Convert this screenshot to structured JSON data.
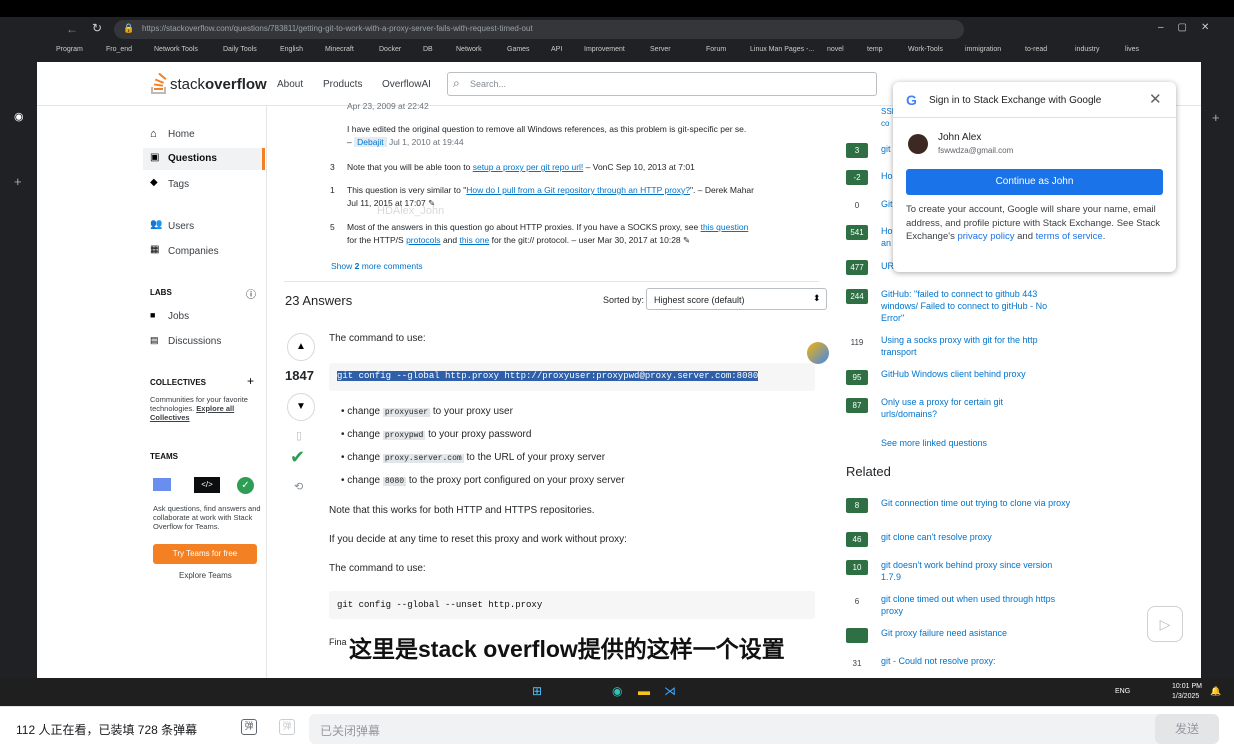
{
  "browser": {
    "url": "https://stackoverflow.com/questions/783811/getting-git-to-work-with-a-proxy-server-fails-with-request-timed-out",
    "bookmarks": [
      "Program",
      "Fro_end",
      "Network Tools",
      "Daily Tools",
      "English",
      "Minecraft",
      "Docker",
      "DB",
      "Network",
      "Games",
      "API",
      "Improvement",
      "Server",
      "Forum",
      "Linux Man Pages -...",
      "novel",
      "temp",
      "Work-Tools",
      "immigration",
      "to-read",
      "industry",
      "lives"
    ]
  },
  "so": {
    "logo_a": "stack",
    "logo_b": "overflow",
    "nav": [
      "About",
      "Products",
      "OverflowAI"
    ],
    "search_placeholder": "Search...",
    "left_nav": {
      "home": "Home",
      "questions": "Questions",
      "tags": "Tags",
      "users": "Users",
      "companies": "Companies"
    },
    "labs": {
      "title": "LABS",
      "jobs": "Jobs",
      "discussions": "Discussions"
    },
    "collectives": {
      "title": "COLLECTIVES",
      "text": "Communities for your favorite technologies.",
      "link": "Explore all Collectives"
    },
    "teams": {
      "title": "TEAMS",
      "text": "Ask questions, find answers and collaborate at work with Stack Overflow for Teams.",
      "button": "Try Teams for free",
      "explore": "Explore Teams"
    }
  },
  "comments": {
    "top_date": "Apr 23, 2009 at 22:42",
    "c1_text": "I have edited the original question to remove all Windows references, as this problem is git-specific per se.",
    "c1_dash": "–",
    "c1_user": "Debajit",
    "c1_date": "Jul 1, 2010 at 19:44",
    "c2_score": "3",
    "c2_pre": "Note that you will be able toon to",
    "c2_link": "setup a proxy per git repo url!",
    "c2_meta": "– VonC Sep 10, 2013 at 7:01",
    "c3_score": "1",
    "c3_pre": "This question is very similar to \"",
    "c3_link": "How do I pull from a Git repository through an HTTP proxy?",
    "c3_meta": "\". – Derek Mahar",
    "c3_date": "Jul 11, 2015 at 17:07",
    "c4_score": "5",
    "c4_pre": "Most of the answers in this question go about HTTP proxies. If you have a SOCKS proxy, see",
    "c4_link": "this question",
    "c4_l2a": "for the HTTP/S",
    "c4_l2b": "protocols",
    "c4_l2c": "and",
    "c4_l2d": "this one",
    "c4_l2e": "for the git:// protocol. – user Mar 30, 2017 at 10:28",
    "show_more_a": "Show",
    "show_more_b": "2",
    "show_more_c": "more comments",
    "watermark": "HDAlex_John"
  },
  "answers": {
    "count": "23 Answers",
    "sorted_by": "Sorted by:",
    "sort_value": "Highest score (default)",
    "score": "1847",
    "intro": "The command to use:",
    "cmd1": "git config --global http.proxy http://proxyuser:proxypwd@proxy.server.com:8080",
    "b1_a": "change",
    "b1_code": "proxyuser",
    "b1_b": "to your proxy user",
    "b2_a": "change",
    "b2_code": "proxypwd",
    "b2_b": "to your proxy password",
    "b3_a": "change",
    "b3_code": "proxy.server.com",
    "b3_b": "to the URL of your proxy server",
    "b4_a": "change",
    "b4_code": "8080",
    "b4_b": "to the proxy port configured on your proxy server",
    "p1": "Note that this works for both HTTP and HTTPS repositories.",
    "p2": "If you decide at any time to reset this proxy and work without proxy:",
    "p3": "The command to use:",
    "cmd2": "git config --global --unset http.proxy",
    "p4": "Fina"
  },
  "sidebar": {
    "linked": [
      {
        "score": "3",
        "text": "git",
        "accepted": true
      },
      {
        "score": "-2",
        "text": "Ho",
        "accepted": true
      },
      {
        "score": "0",
        "text": "Git",
        "accepted": false
      },
      {
        "score": "541",
        "text": "Ho an",
        "accepted": true
      },
      {
        "score": "477",
        "text": "UR",
        "accepted": true
      },
      {
        "score": "244",
        "text": "GitHub: \"failed to connect to github 443 windows/ Failed to connect to gitHub - No Error\"",
        "accepted": true
      },
      {
        "score": "119",
        "text": "Using a socks proxy with git for the http transport",
        "accepted": false
      },
      {
        "score": "95",
        "text": "GitHub Windows client behind proxy",
        "accepted": true
      },
      {
        "score": "87",
        "text": "Only use a proxy for certain git urls/domains?",
        "accepted": true
      }
    ],
    "see_more": "See more linked questions",
    "related_title": "Related",
    "related": [
      {
        "score": "8",
        "text": "Git connection time out trying to clone via proxy",
        "accepted": true
      },
      {
        "score": "46",
        "text": "git clone can't resolve proxy",
        "accepted": true
      },
      {
        "score": "10",
        "text": "git doesn't work behind proxy since version 1.7.9",
        "accepted": true
      },
      {
        "score": "6",
        "text": "git clone timed out when used through https proxy",
        "accepted": false
      },
      {
        "score": "",
        "text": "Git proxy failure need asistance",
        "accepted": true
      },
      {
        "score": "31",
        "text": "git - Could not resolve proxy:",
        "accepted": false
      }
    ],
    "top_cut": "SSI co"
  },
  "google": {
    "title": "Sign in to Stack Exchange with Google",
    "name": "John Alex",
    "email": "fswwdza@gmail.com",
    "button": "Continue as John",
    "info_a": "To create your account, Google will share your name, email address, and profile picture with Stack Exchange. See Stack Exchange's",
    "info_link1": "privacy policy",
    "info_and": "and",
    "info_link2": "terms of service",
    "info_end": "."
  },
  "subtitle": "这里是stack overflow提供的这样一个设置",
  "taskbar": {
    "lang": "ENG",
    "time": "10:01 PM",
    "date": "1/3/2025"
  },
  "danmu": {
    "status": "112 人正在看，已装填 728 条弹幕",
    "placeholder": "已关闭弹幕",
    "send": "发送"
  },
  "colors": {
    "so_orange": "#f48024",
    "accent_blue": "#0074cc",
    "google_blue": "#1a73e8",
    "accepted_green": "#2f6f44"
  }
}
